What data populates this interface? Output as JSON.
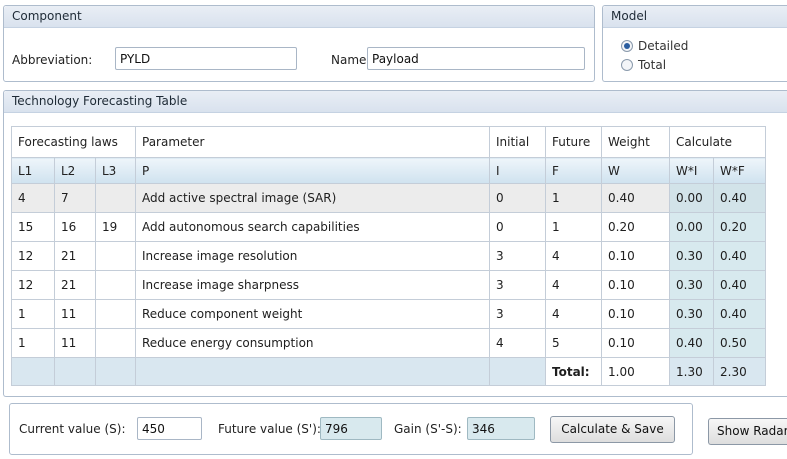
{
  "component": {
    "title": "Component",
    "abbreviation_label": "Abbreviation:",
    "abbreviation_value": "PYLD",
    "name_label": "Name:",
    "name_value": "Payload"
  },
  "model": {
    "title": "Model",
    "options": [
      {
        "label": "Detailed",
        "checked": true
      },
      {
        "label": "Total",
        "checked": false
      }
    ]
  },
  "table": {
    "title": "Technology Forecasting Table",
    "group_headers": {
      "forecasting_laws": "Forecasting laws",
      "parameter": "Parameter",
      "initial": "Initial",
      "future": "Future",
      "weight": "Weight",
      "calculate": "Calculate"
    },
    "sub_headers": [
      "L1",
      "L2",
      "L3",
      "P",
      "I",
      "F",
      "W",
      "W*I",
      "W*F"
    ],
    "rows": [
      {
        "l1": "4",
        "l2": "7",
        "l3": "",
        "p": "Add active spectral image (SAR)",
        "i": "0",
        "f": "1",
        "w": "0.40",
        "wi": "0.00",
        "wf": "0.40"
      },
      {
        "l1": "15",
        "l2": "16",
        "l3": "19",
        "p": "Add autonomous search capabilities",
        "i": "0",
        "f": "1",
        "w": "0.20",
        "wi": "0.00",
        "wf": "0.20"
      },
      {
        "l1": "12",
        "l2": "21",
        "l3": "",
        "p": "Increase image resolution",
        "i": "3",
        "f": "4",
        "w": "0.10",
        "wi": "0.30",
        "wf": "0.40"
      },
      {
        "l1": "12",
        "l2": "21",
        "l3": "",
        "p": "Increase image sharpness",
        "i": "3",
        "f": "4",
        "w": "0.10",
        "wi": "0.30",
        "wf": "0.40"
      },
      {
        "l1": "1",
        "l2": "11",
        "l3": "",
        "p": "Reduce component weight",
        "i": "3",
        "f": "4",
        "w": "0.10",
        "wi": "0.30",
        "wf": "0.40"
      },
      {
        "l1": "1",
        "l2": "11",
        "l3": "",
        "p": "Reduce energy consumption",
        "i": "4",
        "f": "5",
        "w": "0.10",
        "wi": "0.40",
        "wf": "0.50"
      }
    ],
    "totals": {
      "label": "Total:",
      "weight": "1.00",
      "wi": "1.30",
      "wf": "2.30"
    }
  },
  "footer": {
    "current_label": "Current value (S):",
    "current_value": "450",
    "future_label": "Future value (S'):",
    "future_value": "796",
    "gain_label": "Gain (S'-S):",
    "gain_value": "346",
    "calc_button": "Calculate & Save",
    "radar_button": "Show Radar"
  }
}
